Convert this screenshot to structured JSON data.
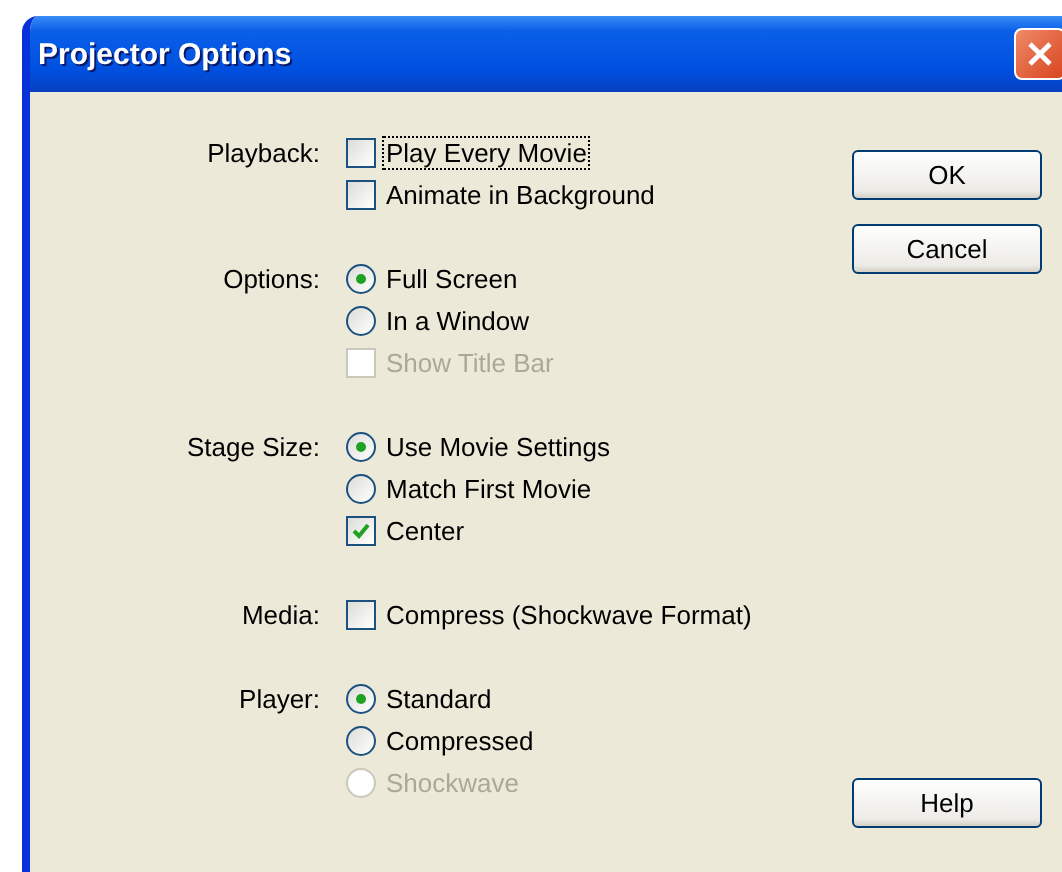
{
  "window": {
    "title": "Projector Options"
  },
  "sections": [
    {
      "label": "Playback:",
      "options": [
        {
          "kind": "checkbox",
          "label": "Play Every Movie",
          "checked": false,
          "disabled": false,
          "focused": true
        },
        {
          "kind": "checkbox",
          "label": "Animate in Background",
          "checked": false,
          "disabled": false,
          "focused": false
        }
      ]
    },
    {
      "label": "Options:",
      "options": [
        {
          "kind": "radio",
          "label": "Full Screen",
          "selected": true,
          "disabled": false,
          "focused": false
        },
        {
          "kind": "radio",
          "label": "In a Window",
          "selected": false,
          "disabled": false,
          "focused": false
        },
        {
          "kind": "checkbox",
          "label": "Show Title Bar",
          "checked": false,
          "disabled": true,
          "focused": false
        }
      ]
    },
    {
      "label": "Stage Size:",
      "options": [
        {
          "kind": "radio",
          "label": "Use Movie Settings",
          "selected": true,
          "disabled": false,
          "focused": false
        },
        {
          "kind": "radio",
          "label": "Match First Movie",
          "selected": false,
          "disabled": false,
          "focused": false
        },
        {
          "kind": "checkbox",
          "label": "Center",
          "checked": true,
          "disabled": false,
          "focused": false
        }
      ]
    },
    {
      "label": "Media:",
      "options": [
        {
          "kind": "checkbox",
          "label": "Compress (Shockwave Format)",
          "checked": false,
          "disabled": false,
          "focused": false
        }
      ]
    },
    {
      "label": "Player:",
      "options": [
        {
          "kind": "radio",
          "label": "Standard",
          "selected": true,
          "disabled": false,
          "focused": false
        },
        {
          "kind": "radio",
          "label": "Compressed",
          "selected": false,
          "disabled": false,
          "focused": false
        },
        {
          "kind": "radio",
          "label": "Shockwave",
          "selected": false,
          "disabled": true,
          "focused": false
        }
      ]
    }
  ],
  "buttons": {
    "top": [
      "OK",
      "Cancel"
    ],
    "bottom": [
      "Help"
    ]
  }
}
